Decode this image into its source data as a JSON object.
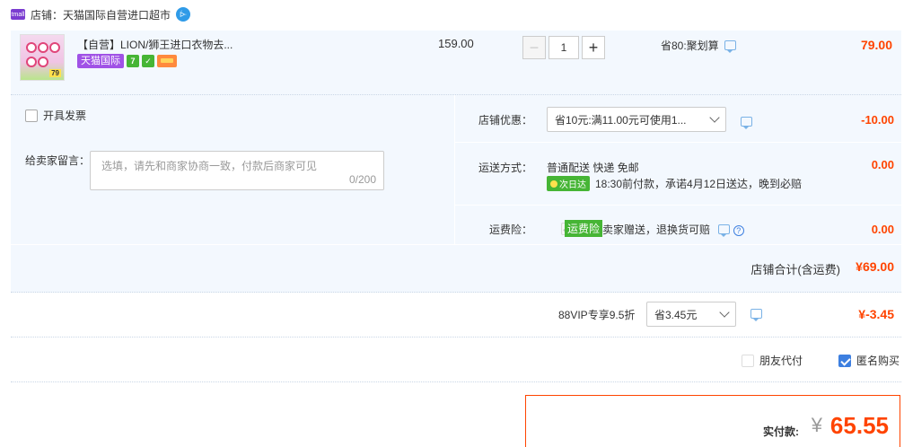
{
  "shop": {
    "label": "店铺：天猫国际自营进口超市",
    "badge_text": "tmall"
  },
  "item": {
    "title": "【自营】LION/狮王进口衣物去...",
    "tag_intl": "天猫国际",
    "tag_7": "7",
    "unit_price": "159.00",
    "quantity": "1",
    "minus": "−",
    "plus": "+",
    "savings": "省80:聚划算",
    "total": "79.00",
    "thumb_price": "79"
  },
  "options": {
    "invoice_label": "开具发票",
    "message_label": "给卖家留言：",
    "message_placeholder": "选填，请先和商家协商一致，付款后商家可见",
    "message_count": "0/200",
    "coupon_label": "店铺优惠：",
    "coupon_value": "省10元:满11.00元可使用1...",
    "coupon_amount": "-10.00",
    "shipping_label": "运送方式：",
    "shipping_method": "普通配送 快递 免邮",
    "nextday_badge": "次日达",
    "shipping_promise": "18:30前付款，承诺4月12日送达，晚到必赔",
    "shipping_amount": "0.00",
    "insurance_label": "运费险：",
    "insurance_badge": "运费险",
    "insurance_text": "卖家赠送，退换货可赔",
    "insurance_amount": "0.00",
    "shop_total_label": "店铺合计(含运费)",
    "shop_total": "¥69.00"
  },
  "vip": {
    "label": "88VIP专享9.5折",
    "select_value": "省3.45元",
    "amount": "¥-3.45"
  },
  "pay": {
    "friend_pay": "朋友代付",
    "anonymous": "匿名购买"
  },
  "final": {
    "label": "实付款:",
    "symbol": "¥",
    "amount": "65.55"
  },
  "colors": {
    "accent": "#ff4400",
    "panel": "#f3f8fe",
    "badge_green": "#46b535",
    "intl_purple": "#a052e6"
  }
}
